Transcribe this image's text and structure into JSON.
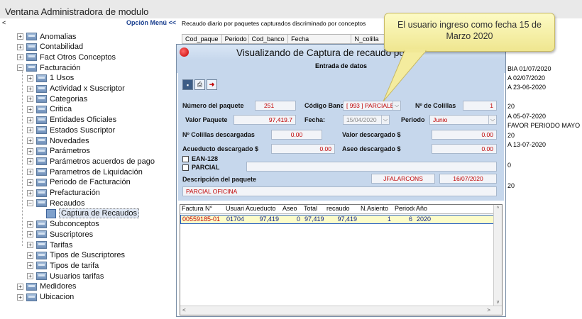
{
  "window": {
    "title": "Ventana Administradora de modulo"
  },
  "menu": {
    "collapse_glyph": "<",
    "label": "Opción Menú <<"
  },
  "tree": {
    "top_items": [
      "Anomalias",
      "Contabilidad",
      "Fact Otros Conceptos",
      "Facturación"
    ],
    "facturacion_children": [
      "1 Usos",
      "Actividad x Suscriptor",
      "Categorias",
      "Critica",
      "Entidades Oficiales",
      "Estados Suscriptor",
      "Novedades",
      "Parámetros",
      "Parámetros acuerdos de pago",
      "Parametros de Liquidación",
      "Periodo de Facturación",
      "Prefacturación",
      "Recaudos"
    ],
    "recaudos_child": "Captura de Recaudos",
    "after_items": [
      "Subconceptos",
      "Suscriptores",
      "Tarifas",
      "Tipos de Suscriptores",
      "Tipos de tarifa",
      "Usuarios tarifas"
    ],
    "bottom_items": [
      "Medidores",
      "Ubicacion"
    ]
  },
  "background_report": {
    "header": "Recaudo diario por paquetes capturados discriminado por conceptos",
    "columns": [
      "Cod_paque",
      "Periodo",
      "Cod_banco",
      "Fecha",
      "N_colilla"
    ],
    "right_entries": [
      "BIA 01/07/2020",
      "A 02/07/2020",
      "A 23-06-2020",
      "20",
      "A 05-07-2020",
      "FAVOR PERIODO MAYO",
      "20",
      "A 13-07-2020",
      "0",
      "20"
    ]
  },
  "modal": {
    "title": "Visualizando de Captura de recaudo por",
    "section": "Entrada de datos",
    "fields": {
      "numero_paquete_label": "Número del paquete",
      "numero_paquete": "251",
      "codigo_banco_label": "Código Banco",
      "codigo_banco": "[ 993 ] PARCIALE",
      "n_colillas_label": "Nº de Colillas",
      "n_colillas": "1",
      "valor_paquete_label": "Valor Paquete",
      "valor_paquete": "97,419.7",
      "fecha_label": "Fecha:",
      "fecha": "15/04/2020",
      "periodo_label": "Periodo",
      "periodo": "Junio",
      "colillas_desc_label": "Nº Colillas descargadas",
      "colillas_desc": "0.00",
      "valor_desc_label": "Valor descargado $",
      "valor_desc": "0.00",
      "acueducto_desc_label": "Acueducto descargado $",
      "acueducto_desc": "0.00",
      "aseo_desc_label": "Aseo descargado $",
      "aseo_desc": "0.00",
      "ean_label": "EAN-128",
      "parcial_label": "PARCIAL",
      "descripcion_label": "Descripción del paquete",
      "usuario": "JFALARCONS",
      "fecha_registro": "16/07/2020",
      "descripcion": "PARCIAL OFICINA"
    },
    "table": {
      "headers": [
        "Factura N°",
        "Usuario",
        "Acueducto",
        "Aseo",
        "Total",
        "recaudo",
        "N.Asiento",
        "Periodo",
        "Año"
      ],
      "row": [
        "00559185-01",
        "01704",
        "97,419",
        "0",
        "97,419",
        "97,419",
        "1",
        "6",
        "2020"
      ]
    }
  },
  "callout": {
    "text": "El usuario ingreso como fecha 15 de Marzo  2020"
  }
}
